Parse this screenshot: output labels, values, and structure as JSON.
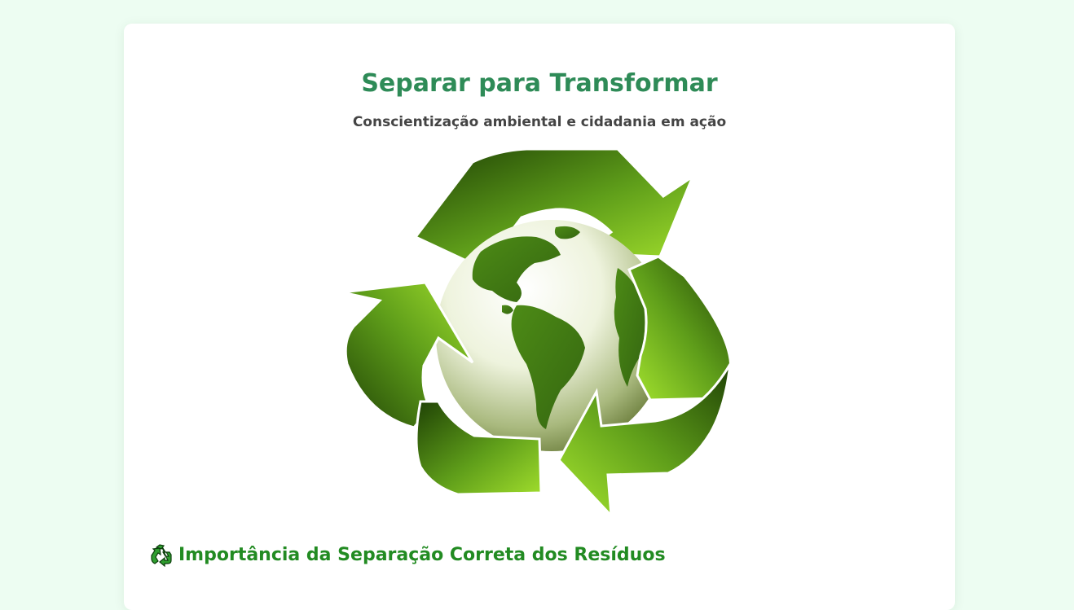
{
  "header": {
    "title": "Separar para Transformar",
    "subtitle": "Conscientização ambiental e cidadania em ação"
  },
  "hero": {
    "icon": "recycling-globe-icon"
  },
  "section": {
    "icon": "recycle-icon",
    "heading": "Importância da Separação Correta dos Resíduos"
  },
  "colors": {
    "background": "#edfdf2",
    "title": "#2e8b57",
    "subtitle": "#444444",
    "section_heading": "#228b22"
  }
}
